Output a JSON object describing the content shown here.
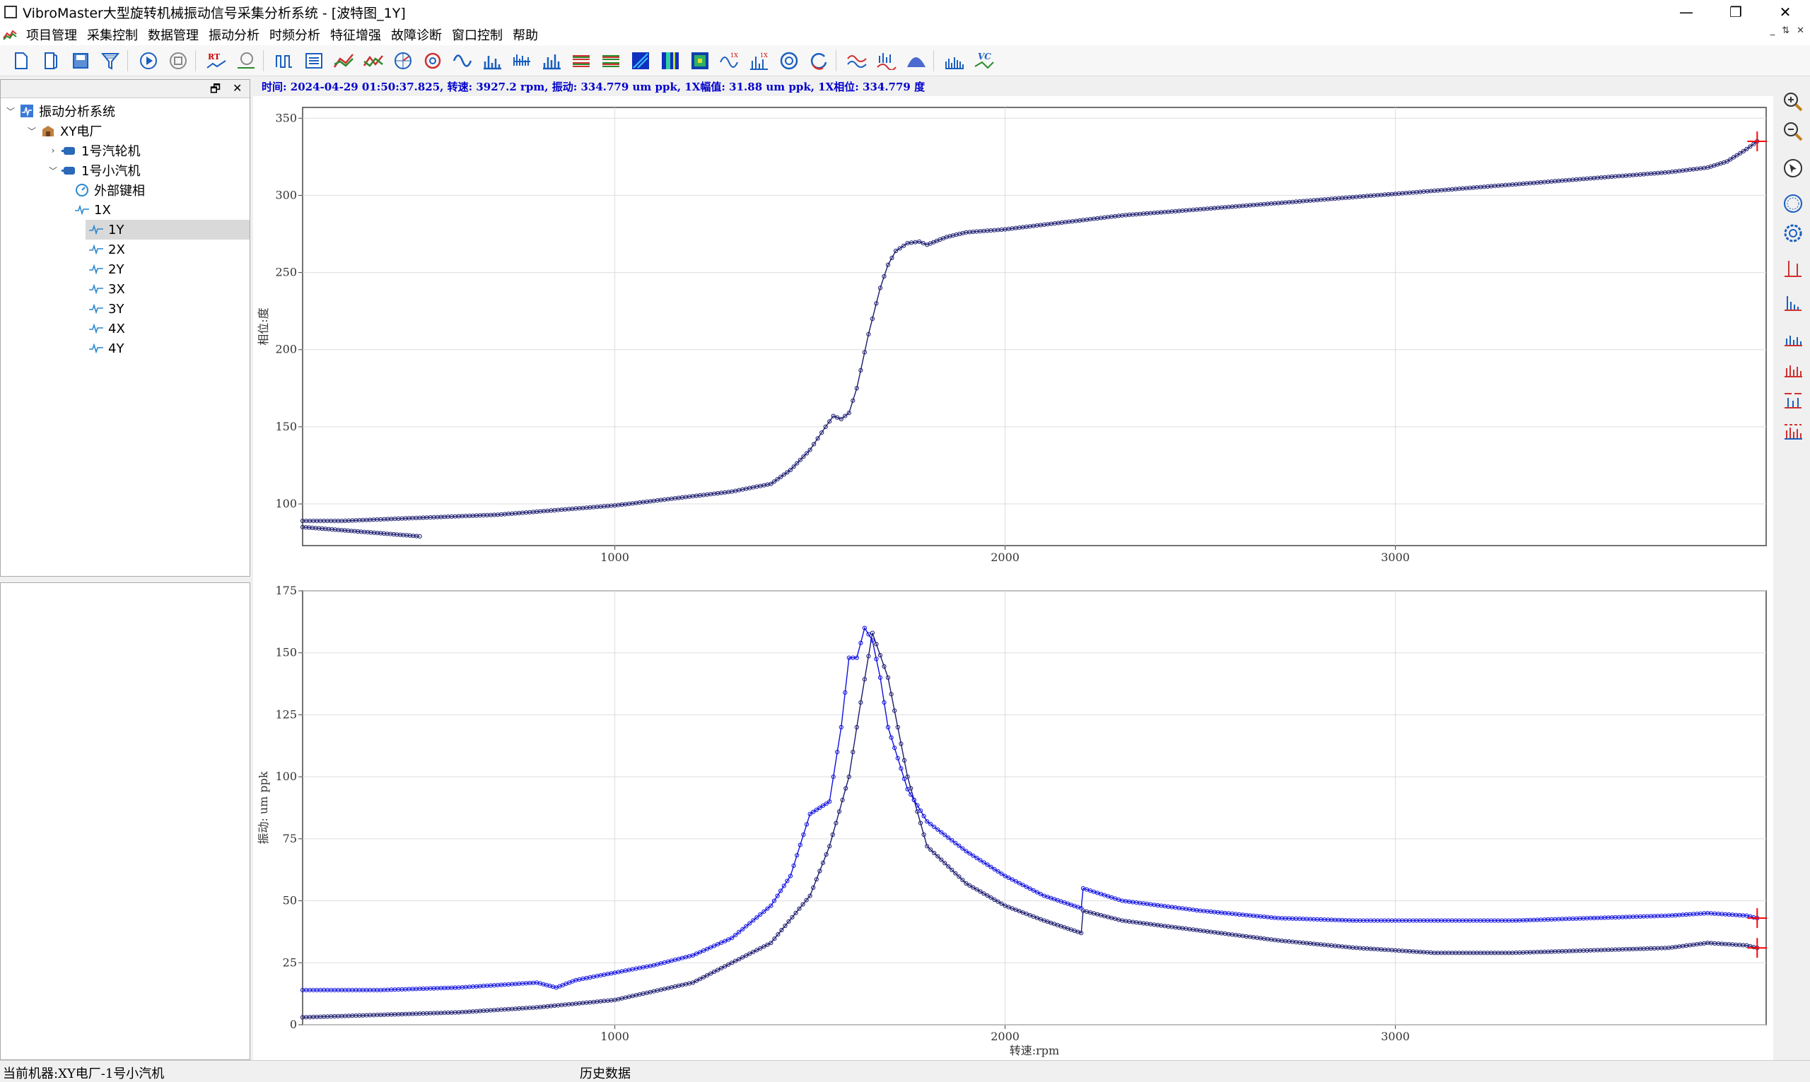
{
  "window": {
    "title": "VibroMaster大型旋转机械振动信号采集分析系统 - [波特图_1Y]",
    "controls": [
      "—",
      "❐",
      "✕"
    ]
  },
  "menu": {
    "items": [
      "项目管理",
      "采集控制",
      "数据管理",
      "振动分析",
      "时频分析",
      "特征增强",
      "故障诊断",
      "窗口控制",
      "帮助"
    ],
    "mdi_controls": [
      "_",
      "⇅",
      "✕"
    ]
  },
  "toolbar": {
    "icons": [
      "new-file-icon",
      "open-file-icon",
      "save-icon",
      "filter-icon",
      "play-icon",
      "stop-icon",
      "realtime-icon",
      "timer-icon",
      "waveform-icon",
      "list-icon",
      "trend-icon",
      "trend2-icon",
      "polar-icon",
      "orbit-icon",
      "sine-icon",
      "spectrum-icon",
      "cascade-icon",
      "bar-spectrum-icon",
      "waterfall-icon",
      "waterfall2-icon",
      "spectrogram-icon",
      "spectrogram2-icon",
      "spectrogram3-icon",
      "1x-wave-icon",
      "1x-spectrum-icon",
      "circle-icon",
      "refresh-icon",
      "wave-compare-icon",
      "spectrum-compare-icon",
      "envelope-icon",
      "histogram-icon",
      "vc-icon"
    ],
    "rt_label": "RT",
    "vc_label": "VC"
  },
  "tree": {
    "pane_controls": [
      "🗗",
      "✕"
    ],
    "root": "振动分析系统",
    "plant": "XY电厂",
    "machines": [
      "1号汽轮机",
      "1号小汽机"
    ],
    "keyphasor": "外部键相",
    "channels": [
      "1X",
      "1Y",
      "2X",
      "2Y",
      "3X",
      "3Y",
      "4X",
      "4Y"
    ],
    "selected": "1Y"
  },
  "info_line": "时间: 2024-04-29 01:50:37.825, 转速: 3927.2 rpm, 振动: 334.779 um ppk, 1X幅值: 31.88 um ppk, 1X相位: 334.779 度",
  "status": {
    "machine": "当前机器:XY电厂-1号小汽机",
    "mode": "历史数据"
  },
  "colors": {
    "series_dark": "#1a1a6e",
    "series_blue": "#1010e0",
    "marker_red": "#ff0000",
    "grid": "#dddddd"
  },
  "chart_data": [
    {
      "type": "line",
      "title": "",
      "xlabel": "",
      "ylabel": "相位:度",
      "xlim": [
        200,
        3950
      ],
      "ylim": [
        73,
        357
      ],
      "xticks": [
        1000,
        2000,
        3000
      ],
      "yticks": [
        100,
        150,
        200,
        250,
        300,
        350
      ],
      "grid": true,
      "series": [
        {
          "color": "dark",
          "x": [
            200,
            300,
            400,
            500,
            600,
            700,
            800,
            900,
            1000,
            1100,
            1200,
            1300,
            1400,
            1450,
            1500,
            1540,
            1560,
            1580,
            1600,
            1620,
            1650,
            1680,
            1700,
            1720,
            1750,
            1780,
            1800,
            1850,
            1900,
            2000,
            2100,
            2200,
            2300,
            2400,
            2500,
            2600,
            2700,
            2800,
            2900,
            3000,
            3100,
            3200,
            3300,
            3400,
            3500,
            3600,
            3700,
            3800,
            3850,
            3900,
            3927
          ],
          "y": [
            89,
            89,
            90,
            91,
            92,
            93,
            95,
            97,
            99,
            102,
            105,
            108,
            113,
            122,
            135,
            150,
            157,
            155,
            159,
            175,
            210,
            240,
            255,
            264,
            269,
            270,
            268,
            273,
            276,
            278,
            281,
            284,
            287,
            289,
            291,
            293,
            295,
            297,
            299,
            301,
            303,
            305,
            307,
            309,
            311,
            313,
            315,
            318,
            322,
            330,
            335
          ]
        },
        {
          "color": "dark",
          "x": [
            200,
            250,
            300,
            350,
            400,
            450,
            500
          ],
          "y": [
            85,
            84,
            83,
            82,
            81,
            80,
            79
          ]
        }
      ]
    },
    {
      "type": "line",
      "title": "",
      "xlabel": "转速:rpm",
      "ylabel": "振动: um ppk",
      "xlim": [
        200,
        3950
      ],
      "ylim": [
        0,
        175
      ],
      "xticks": [
        1000,
        2000,
        3000
      ],
      "yticks": [
        0,
        25,
        50,
        75,
        100,
        125,
        150,
        175
      ],
      "grid": true,
      "series": [
        {
          "color": "dark",
          "x": [
            200,
            400,
            600,
            800,
            1000,
            1200,
            1400,
            1500,
            1550,
            1600,
            1630,
            1660,
            1700,
            1750,
            1800,
            1900,
            2000,
            2100,
            2195,
            2200,
            2300,
            2500,
            2700,
            2900,
            3100,
            3300,
            3500,
            3700,
            3800,
            3900,
            3927
          ],
          "y": [
            3,
            4,
            5,
            7,
            10,
            17,
            33,
            52,
            72,
            100,
            130,
            158,
            140,
            100,
            72,
            57,
            48,
            42,
            37,
            46,
            42,
            38,
            34,
            31,
            29,
            29,
            30,
            31,
            33,
            32,
            31
          ]
        },
        {
          "color": "blue",
          "x": [
            200,
            400,
            600,
            800,
            850,
            900,
            1000,
            1100,
            1200,
            1300,
            1400,
            1450,
            1500,
            1550,
            1580,
            1600,
            1620,
            1640,
            1660,
            1680,
            1700,
            1750,
            1800,
            1900,
            2000,
            2100,
            2195,
            2200,
            2300,
            2500,
            2700,
            2900,
            3100,
            3300,
            3500,
            3700,
            3800,
            3900,
            3927
          ],
          "y": [
            14,
            14,
            15,
            17,
            15,
            18,
            21,
            24,
            28,
            35,
            48,
            60,
            85,
            90,
            120,
            148,
            148,
            160,
            155,
            140,
            120,
            95,
            82,
            70,
            60,
            52,
            47,
            55,
            50,
            46,
            43,
            42,
            42,
            42,
            43,
            44,
            45,
            44,
            43
          ]
        }
      ]
    }
  ]
}
